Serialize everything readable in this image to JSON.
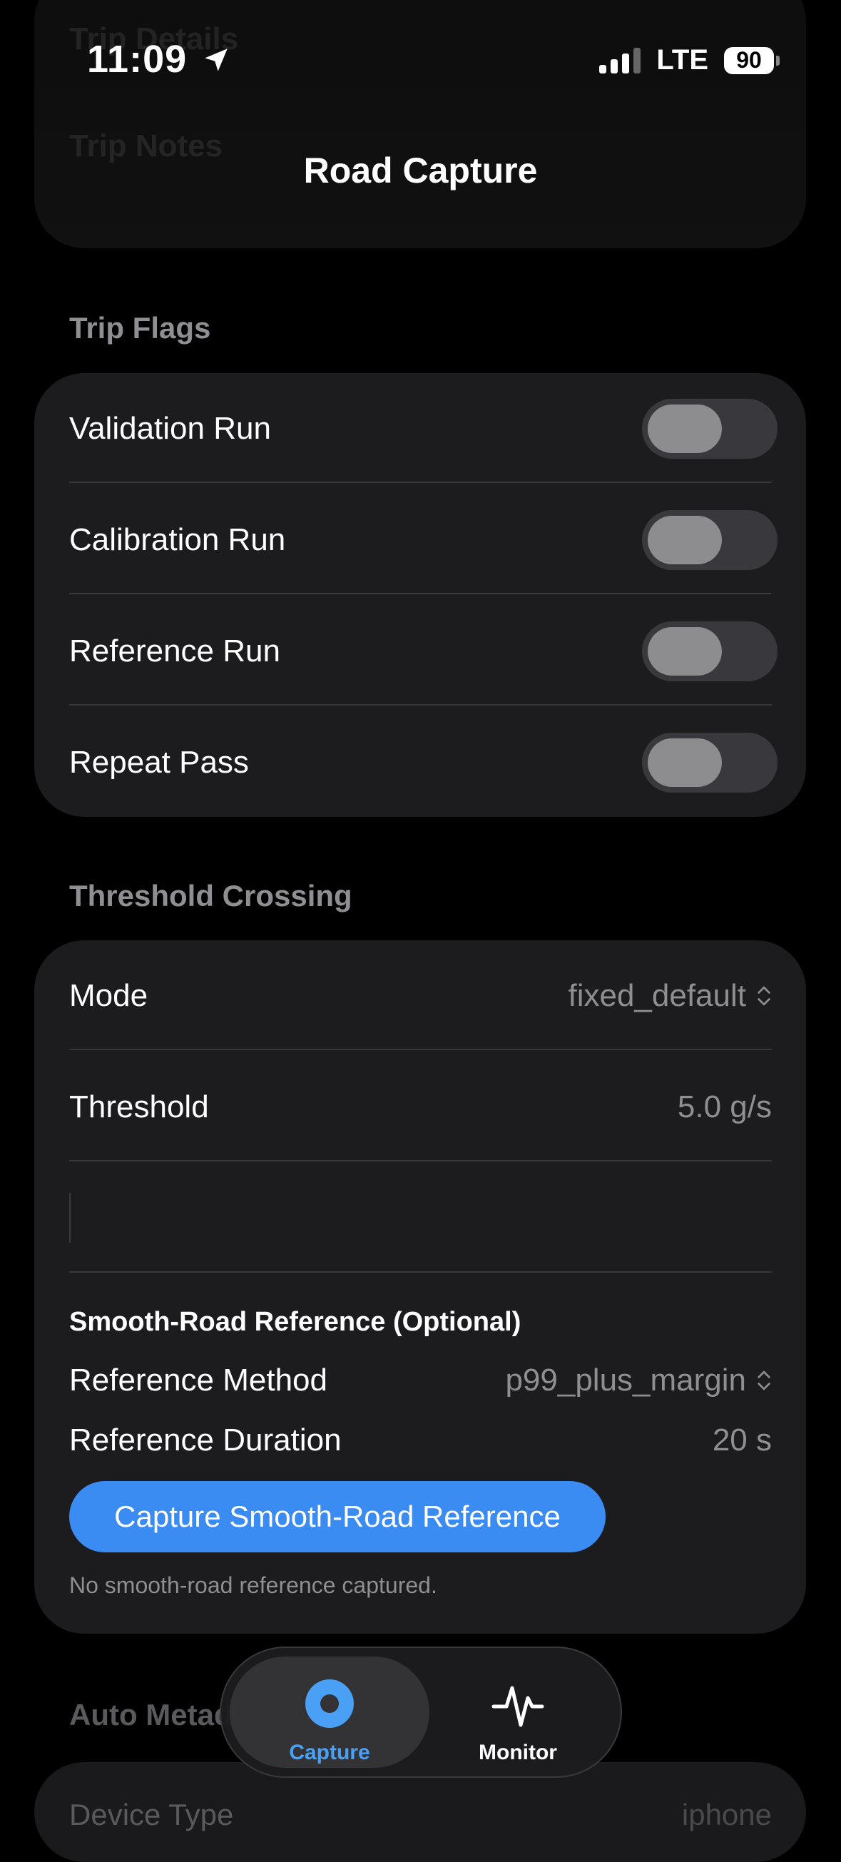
{
  "status_bar": {
    "time": "11:09",
    "network": "LTE",
    "battery": "90"
  },
  "header": {
    "title": "Road Capture",
    "ghost_lines": [
      "Trip Details",
      "Trip Notes"
    ]
  },
  "trip_flags": {
    "label": "Trip Flags",
    "items": [
      {
        "label": "Validation Run",
        "on": false
      },
      {
        "label": "Calibration Run",
        "on": false
      },
      {
        "label": "Reference Run",
        "on": false
      },
      {
        "label": "Repeat Pass",
        "on": false
      }
    ]
  },
  "threshold": {
    "label": "Threshold Crossing",
    "mode_label": "Mode",
    "mode_value": "fixed_default",
    "threshold_label": "Threshold",
    "threshold_value": "5.0 g/s",
    "smooth_road": {
      "heading": "Smooth-Road Reference (Optional)",
      "method_label": "Reference Method",
      "method_value": "p99_plus_margin",
      "duration_label": "Reference Duration",
      "duration_value": "20 s",
      "button_label": "Capture Smooth-Road Reference",
      "note": "No smooth-road reference captured."
    }
  },
  "bottom": {
    "section_label": "Auto Metadata",
    "device_type_label": "Device Type",
    "device_type_value": "iphone"
  },
  "tabbar": {
    "tabs": [
      {
        "label": "Capture",
        "active": true
      },
      {
        "label": "Monitor",
        "active": false
      }
    ],
    "accent": "#4aa0f5"
  }
}
